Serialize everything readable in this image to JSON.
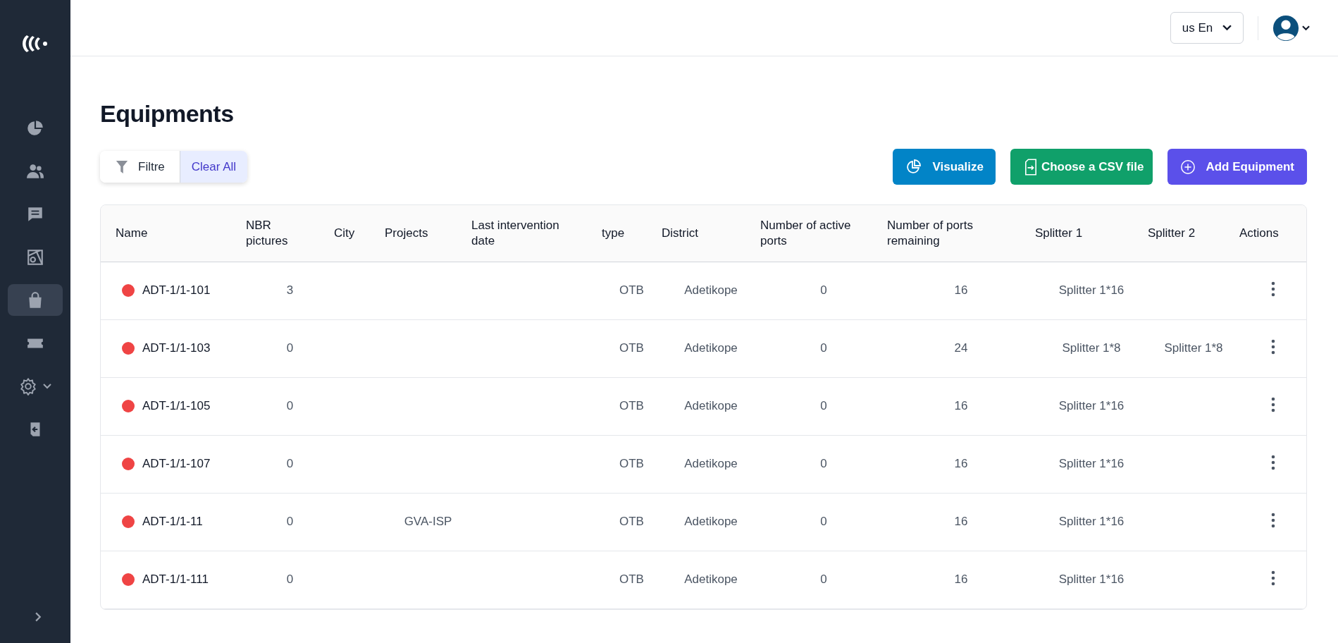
{
  "sidebar": {
    "items": [
      {
        "kind": "chart",
        "selected": false
      },
      {
        "kind": "users",
        "selected": false
      },
      {
        "kind": "chat",
        "selected": false
      },
      {
        "kind": "map",
        "selected": false
      },
      {
        "kind": "bag",
        "selected": true
      },
      {
        "kind": "ticket",
        "selected": false
      },
      {
        "kind": "settings",
        "selected": false,
        "expandable": true
      },
      {
        "kind": "logout",
        "selected": false
      }
    ]
  },
  "header": {
    "language": "us En"
  },
  "page": {
    "title": "Equipments"
  },
  "filter": {
    "label": "Filtre",
    "clear": "Clear All"
  },
  "actions": [
    {
      "kind": "visualize",
      "label": "Visualize"
    },
    {
      "kind": "csv",
      "label": "Choose a CSV file"
    },
    {
      "kind": "add",
      "label": "Add Equipment"
    }
  ],
  "table": {
    "columns": [
      "Name",
      "NBR pictures",
      "City",
      "Projects",
      "Last intervention date",
      "type",
      "District",
      "Number of active ports",
      "Number of ports remaining",
      "Splitter 1",
      "Splitter 2",
      "Actions"
    ],
    "rows": [
      {
        "color": "#ef4444",
        "cells": [
          "ADT-1/1-101",
          "3",
          "",
          "",
          "",
          "OTB",
          "Adetikope",
          "0",
          "16",
          "Splitter 1*16",
          ""
        ]
      },
      {
        "color": "#ef4444",
        "cells": [
          "ADT-1/1-103",
          "0",
          "",
          "",
          "",
          "OTB",
          "Adetikope",
          "0",
          "24",
          "Splitter 1*8",
          "Splitter 1*8"
        ]
      },
      {
        "color": "#ef4444",
        "cells": [
          "ADT-1/1-105",
          "0",
          "",
          "",
          "",
          "OTB",
          "Adetikope",
          "0",
          "16",
          "Splitter 1*16",
          ""
        ]
      },
      {
        "color": "#ef4444",
        "cells": [
          "ADT-1/1-107",
          "0",
          "",
          "",
          "",
          "OTB",
          "Adetikope",
          "0",
          "16",
          "Splitter 1*16",
          ""
        ]
      },
      {
        "color": "#ef4444",
        "cells": [
          "ADT-1/1-11",
          "0",
          "",
          "GVA-ISP",
          "",
          "OTB",
          "Adetikope",
          "0",
          "16",
          "Splitter 1*16",
          ""
        ]
      },
      {
        "color": "#ef4444",
        "cells": [
          "ADT-1/1-111",
          "0",
          "",
          "",
          "",
          "OTB",
          "Adetikope",
          "0",
          "16",
          "Splitter 1*16",
          ""
        ]
      }
    ]
  }
}
